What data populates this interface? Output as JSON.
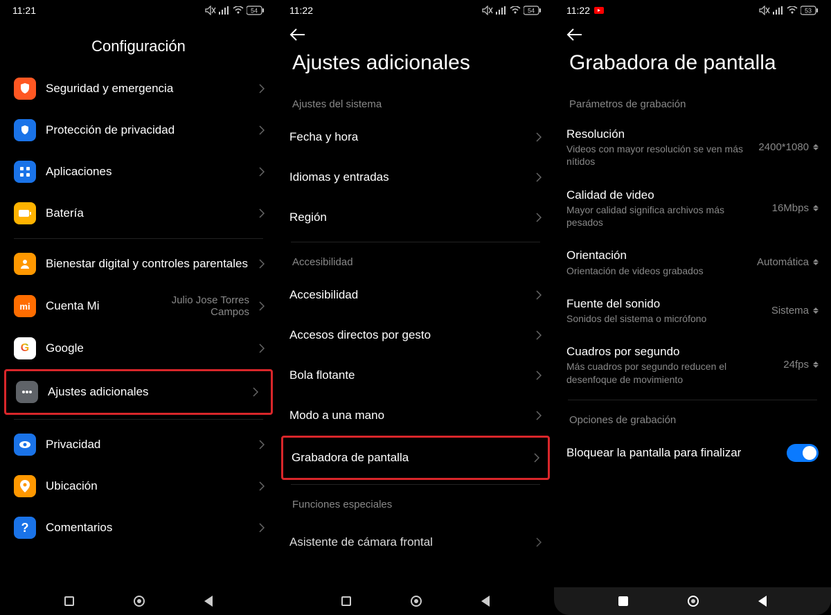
{
  "screen1": {
    "time": "11:21",
    "battery": "54",
    "title": "Configuración",
    "items": [
      {
        "label": "Seguridad y emergencia",
        "icon_bg": "#ff5722",
        "icon": "shield"
      },
      {
        "label": "Protección de privacidad",
        "icon_bg": "#1a73e8",
        "icon": "lock"
      },
      {
        "label": "Aplicaciones",
        "icon_bg": "#1a73e8",
        "icon": "apps"
      },
      {
        "label": "Batería",
        "icon_bg": "#ffb300",
        "icon": "battery"
      }
    ],
    "items2": [
      {
        "label": "Bienestar digital y controles parentales",
        "icon_bg": "#ff9800",
        "icon": "person"
      },
      {
        "label": "Cuenta Mi",
        "value": "Julio Jose Torres Campos",
        "icon_bg": "#ff6d00",
        "icon": "mi"
      },
      {
        "label": "Google",
        "icon_bg": "#ffffff",
        "icon": "google"
      },
      {
        "label": "Ajustes adicionales",
        "icon_bg": "#5f6368",
        "icon": "dots",
        "highlight": true
      }
    ],
    "items3": [
      {
        "label": "Privacidad",
        "icon_bg": "#1a73e8",
        "icon": "eye"
      },
      {
        "label": "Ubicación",
        "icon_bg": "#ff9800",
        "icon": "pin"
      },
      {
        "label": "Comentarios",
        "icon_bg": "#1a73e8",
        "icon": "question"
      }
    ]
  },
  "screen2": {
    "time": "11:22",
    "battery": "54",
    "title": "Ajustes adicionales",
    "section1_header": "Ajustes del sistema",
    "section1": [
      {
        "label": "Fecha y hora"
      },
      {
        "label": "Idiomas y entradas"
      },
      {
        "label": "Región"
      }
    ],
    "section2_header": "Accesibilidad",
    "section2": [
      {
        "label": "Accesibilidad"
      },
      {
        "label": "Accesos directos por gesto"
      },
      {
        "label": "Bola flotante"
      },
      {
        "label": "Modo a una mano"
      },
      {
        "label": "Grabadora de pantalla",
        "highlight": true
      }
    ],
    "section3_header": "Funciones especiales",
    "section3_item": "Asistente de cámara frontal"
  },
  "screen3": {
    "time": "11:22",
    "battery": "53",
    "title": "Grabadora de pantalla",
    "section1_header": "Parámetros de grabación",
    "params": [
      {
        "label": "Resolución",
        "sub": "Videos con mayor resolución se ven más nítidos",
        "value": "2400*1080"
      },
      {
        "label": "Calidad de video",
        "sub": "Mayor calidad significa archivos más pesados",
        "value": "16Mbps"
      },
      {
        "label": "Orientación",
        "sub": "Orientación de videos grabados",
        "value": "Automática"
      },
      {
        "label": "Fuente del sonido",
        "sub": "Sonidos del sistema o micrófono",
        "value": "Sistema"
      },
      {
        "label": "Cuadros por segundo",
        "sub": "Más cuadros por segundo reducen el desenfoque de movimiento",
        "value": "24fps"
      }
    ],
    "section2_header": "Opciones de grabación",
    "toggle_label": "Bloquear la pantalla para finalizar"
  }
}
